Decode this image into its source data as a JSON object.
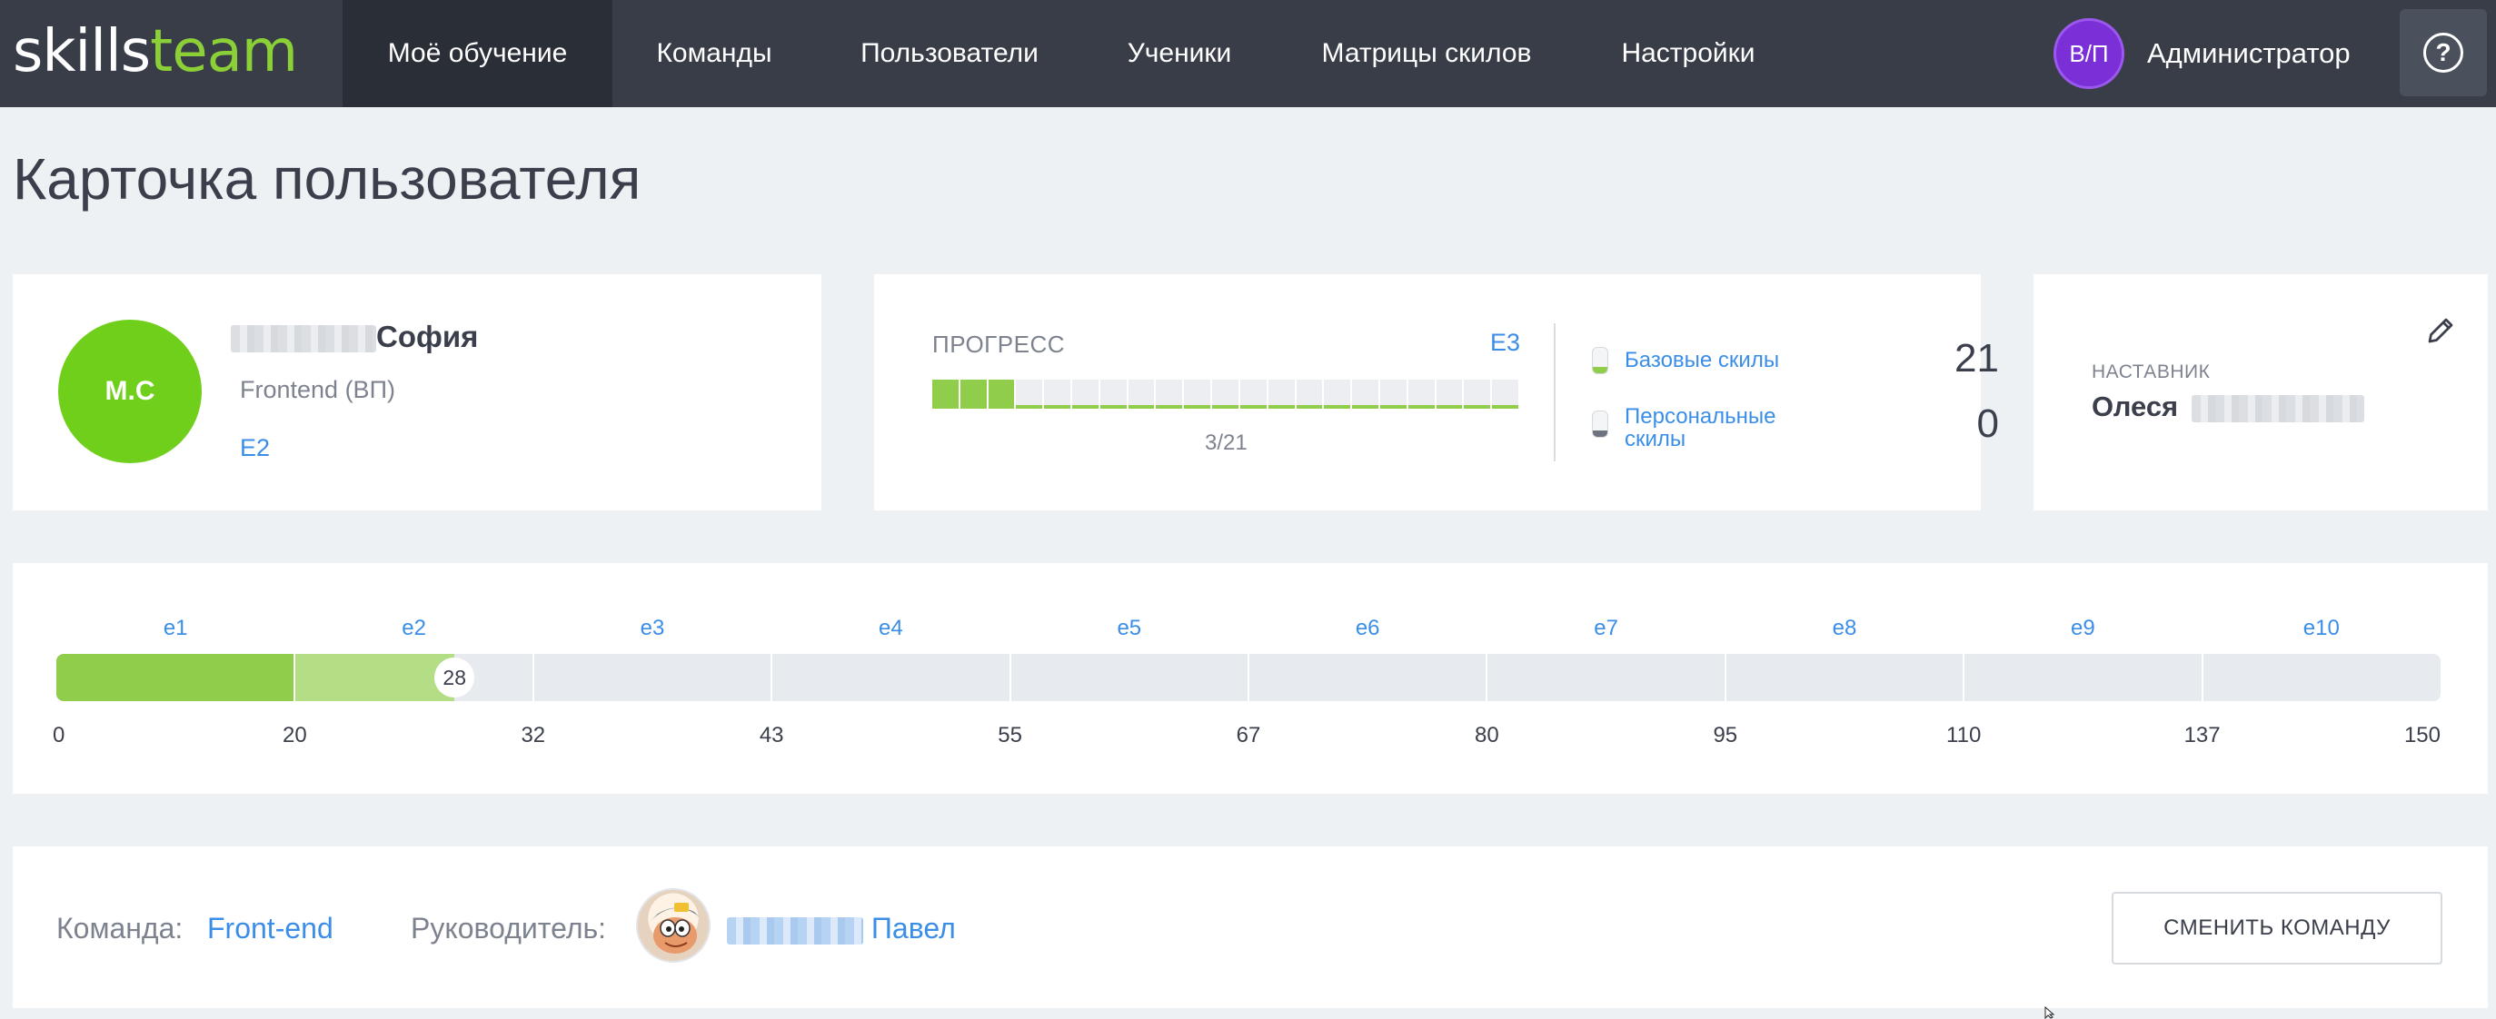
{
  "app": {
    "logo_part1": "skills",
    "logo_part2": "team",
    "brand_color": "#8cd037"
  },
  "nav": {
    "items": [
      {
        "label": "Моё обучение",
        "active": true
      },
      {
        "label": "Команды"
      },
      {
        "label": "Пользователи"
      },
      {
        "label": "Ученики"
      },
      {
        "label": "Матрицы скилов"
      },
      {
        "label": "Настройки"
      }
    ],
    "user_initials": "В/П",
    "user_name": "Администратор",
    "help_icon": "question-circle-icon",
    "help_glyph": "?"
  },
  "page": {
    "title": "Карточка пользователя"
  },
  "profile": {
    "initials": "М.С",
    "first_name": "София",
    "role": "Frontend (ВП)",
    "level": "E2"
  },
  "progress": {
    "label": "ПРОГРЕСС",
    "level": "E3",
    "done": 3,
    "total": 21,
    "count_text": "3/21",
    "base_skills_label": "Базовые скилы",
    "base_skills_count": "21",
    "personal_skills_label": "Персональные скилы",
    "personal_skills_count": "0"
  },
  "mentor": {
    "label": "НАСТАВНИК",
    "first_name": "Олеся",
    "edit_icon": "pencil-icon"
  },
  "level_scale": {
    "levels": [
      "e1",
      "e2",
      "e3",
      "e4",
      "e5",
      "e6",
      "e7",
      "e8",
      "e9",
      "e10"
    ],
    "thresholds": [
      "0",
      "20",
      "32",
      "43",
      "55",
      "67",
      "80",
      "95",
      "110",
      "137",
      "150"
    ],
    "current_points": "28",
    "completed_level_count": 1,
    "current_fraction_of_level": 0.67,
    "colors": {
      "done": "#8fcd4a",
      "current": "#b3de86",
      "track": "#e7eaef"
    }
  },
  "team": {
    "team_label": "Команда:",
    "team_name": "Front-end",
    "lead_label": "Руководитель:",
    "lead_first_name": "Павел",
    "change_button": "СМЕНИТЬ КОМАНДУ"
  }
}
